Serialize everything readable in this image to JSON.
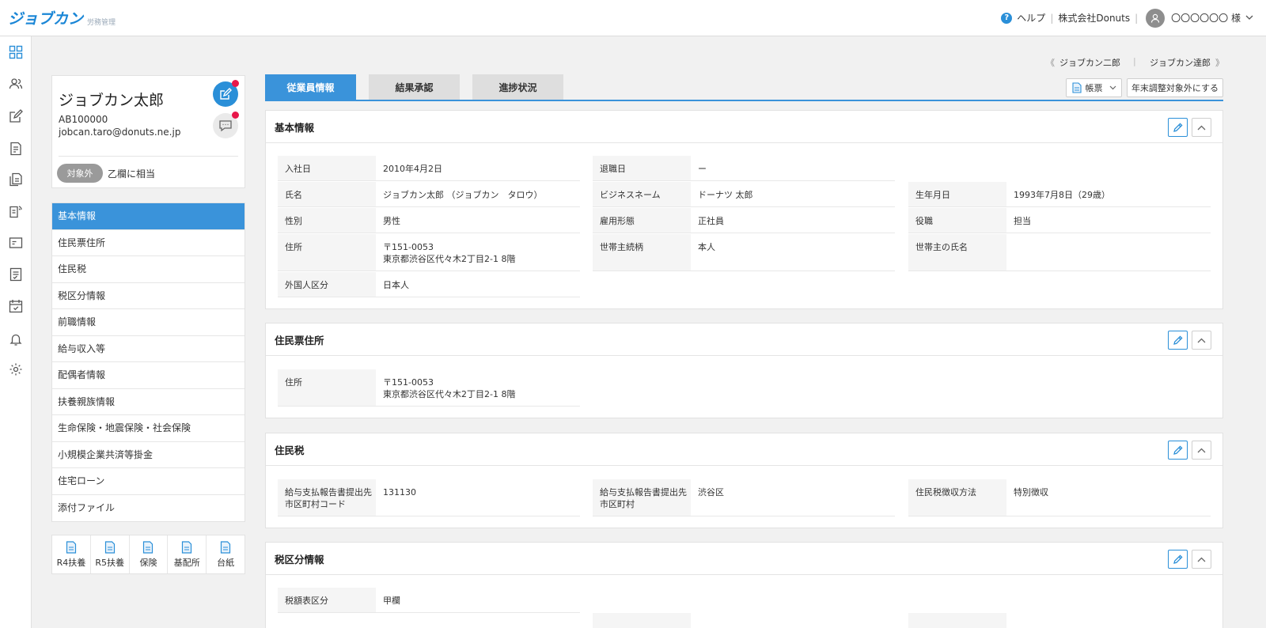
{
  "header": {
    "logo": "ジョブカン",
    "logo_sub": "労務管理",
    "help": "ヘルプ",
    "company": "株式会社Donuts",
    "user": "〇〇〇〇〇〇 様"
  },
  "rail": {
    "icons": [
      "dashboard-icon",
      "users-icon",
      "edit-icon",
      "document-icon",
      "documents-icon",
      "broadcast-doc-icon",
      "id-card-icon",
      "checklist-icon",
      "calendar-icon",
      "bell-icon",
      "gear-icon"
    ]
  },
  "profile": {
    "name": "ジョブカン太郎",
    "employee_id": "AB100000",
    "email": "jobcan.taro@donuts.ne.jp",
    "badge": "対象外",
    "status": "乙欄に相当"
  },
  "sidenav": {
    "items": [
      "基本情報",
      "住民票住所",
      "住民税",
      "税区分情報",
      "前職情報",
      "給与収入等",
      "配偶者情報",
      "扶養親族情報",
      "生命保険・地震保険・社会保険",
      "小規模企業共済等掛金",
      "住宅ローン",
      "添付ファイル"
    ]
  },
  "docbar": {
    "items": [
      "R4扶養",
      "R5扶養",
      "保険",
      "基配所",
      "台紙"
    ]
  },
  "pager": {
    "prev": "ジョブカン二郎",
    "next": "ジョブカン達郎",
    "prev_glyph": "《",
    "next_glyph": "》"
  },
  "tabs": [
    "従業員情報",
    "結果承認",
    "進捗状況"
  ],
  "actions": {
    "report": "帳票",
    "exclude": "年末調整対象外にする"
  },
  "sections": {
    "basic": {
      "title": "基本情報",
      "hire_label": "入社日",
      "hire": "2010年4月2日",
      "retire_label": "退職日",
      "retire": "ー",
      "name_label": "氏名",
      "name": "ジョブカン太郎 （ジョブカン　タロウ）",
      "bizname_label": "ビジネスネーム",
      "bizname": "ドーナツ 太郎",
      "birth_label": "生年月日",
      "birth": "1993年7月8日（29歳）",
      "gender_label": "性別",
      "gender": "男性",
      "emptype_label": "雇用形態",
      "emptype": "正社員",
      "position_label": "役職",
      "position": "担当",
      "address_label": "住所",
      "address1": "〒151-0053",
      "address2": "東京都渋谷区代々木2丁目2-1 8階",
      "relation_label": "世帯主続柄",
      "relation": "本人",
      "hhname_label": "世帯主の氏名",
      "foreign_label": "外国人区分",
      "foreign": "日本人"
    },
    "resident_address": {
      "title": "住民票住所",
      "address_label": "住所",
      "address1": "〒151-0053",
      "address2": "東京都渋谷区代々木2丁目2-1 8階"
    },
    "resident_tax": {
      "title": "住民税",
      "code_label1": "給与支払報告書提出先",
      "code_label2": "市区町村コード",
      "code": "131130",
      "city_label1": "給与支払報告書提出先",
      "city_label2": "市区町村",
      "city": "渋谷区",
      "method_label": "住民税徴収方法",
      "method": "特別徴収"
    },
    "tax_class": {
      "title": "税区分情報",
      "table_label": "税額表区分",
      "table": "甲欄"
    }
  }
}
